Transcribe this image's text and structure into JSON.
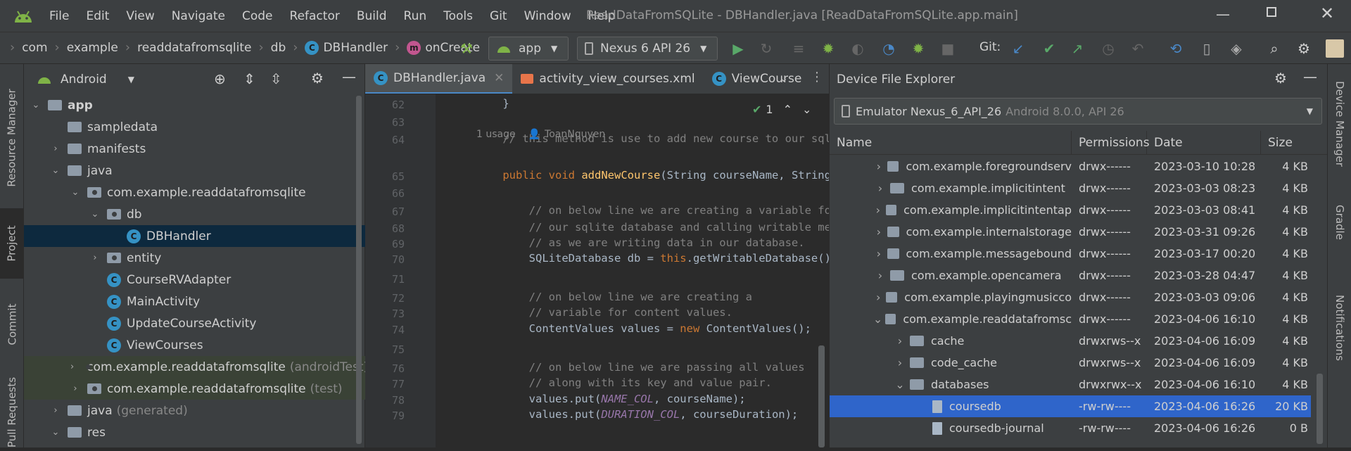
{
  "menu": {
    "items": [
      "File",
      "Edit",
      "View",
      "Navigate",
      "Code",
      "Refactor",
      "Build",
      "Run",
      "Tools",
      "Git",
      "Window",
      "Help"
    ],
    "title": "ReadDataFromSQLite - DBHandler.java [ReadDataFromSQLite.app.main]"
  },
  "breadcrumb": [
    "com",
    "example",
    "readdatafromsqlite",
    "db",
    "DBHandler",
    "onCreate"
  ],
  "toolbar": {
    "run_config": "app",
    "device": "Nexus 6 API 26",
    "git_label": "Git:"
  },
  "side_tabs": {
    "left": [
      "Resource Manager",
      "Project",
      "Commit",
      "Pull Requests"
    ],
    "right": [
      "Device Manager",
      "Gradle",
      "Notifications"
    ]
  },
  "project": {
    "view_label": "Android",
    "tree": [
      {
        "label": "app",
        "dim": ""
      },
      {
        "label": "sampledata",
        "dim": ""
      },
      {
        "label": "manifests",
        "dim": ""
      },
      {
        "label": "java",
        "dim": ""
      },
      {
        "label": "com.example.readdatafromsqlite",
        "dim": ""
      },
      {
        "label": "db",
        "dim": ""
      },
      {
        "label": "DBHandler",
        "dim": ""
      },
      {
        "label": "entity",
        "dim": ""
      },
      {
        "label": "CourseRVAdapter",
        "dim": ""
      },
      {
        "label": "MainActivity",
        "dim": ""
      },
      {
        "label": "UpdateCourseActivity",
        "dim": ""
      },
      {
        "label": "ViewCourses",
        "dim": ""
      },
      {
        "label": "com.example.readdatafromsqlite",
        "dim": "(androidTest)"
      },
      {
        "label": "com.example.readdatafromsqlite",
        "dim": "(test)"
      },
      {
        "label": "java",
        "dim": "(generated)"
      },
      {
        "label": "res",
        "dim": ""
      }
    ]
  },
  "editor": {
    "tabs": [
      "DBHandler.java",
      "activity_view_courses.xml",
      "ViewCourse"
    ],
    "inspection_count": "1",
    "usage_hint": "1 usage",
    "author": "ToanNguyen",
    "lines": [
      {
        "n": "62",
        "code": "    }"
      },
      {
        "n": "63",
        "code": ""
      },
      {
        "n": "64",
        "code": "    // this method is use to add new course to our sql"
      },
      {
        "n": "65",
        "code": "    public void addNewCourse(String courseName, String"
      },
      {
        "n": "66",
        "code": ""
      },
      {
        "n": "67",
        "code": "        // on below line we are creating a variable fo"
      },
      {
        "n": "68",
        "code": "        // our sqlite database and calling writable me"
      },
      {
        "n": "69",
        "code": "        // as we are writing data in our database."
      },
      {
        "n": "70",
        "code": "        SQLiteDatabase db = this.getWritableDatabase()"
      },
      {
        "n": "71",
        "code": ""
      },
      {
        "n": "72",
        "code": "        // on below line we are creating a"
      },
      {
        "n": "73",
        "code": "        // variable for content values."
      },
      {
        "n": "74",
        "code": "        ContentValues values = new ContentValues();"
      },
      {
        "n": "75",
        "code": ""
      },
      {
        "n": "76",
        "code": "        // on below line we are passing all values"
      },
      {
        "n": "77",
        "code": "        // along with its key and value pair."
      },
      {
        "n": "78",
        "code": "        values.put(NAME_COL, courseName);"
      },
      {
        "n": "79",
        "code": "        values.put(DURATION_COL, courseDuration);"
      }
    ]
  },
  "dfe": {
    "title": "Device File Explorer",
    "device": "Emulator Nexus_6_API_26",
    "device_detail": "Android 8.0.0, API 26",
    "columns": [
      "Name",
      "Permissions",
      "Date",
      "Size"
    ],
    "rows": [
      {
        "name": "com.example.foregroundserv",
        "perm": "drwx------",
        "date": "2023-03-10 10:28",
        "size": "4 KB"
      },
      {
        "name": "com.example.implicitintent",
        "perm": "drwx------",
        "date": "2023-03-03 08:23",
        "size": "4 KB"
      },
      {
        "name": "com.example.implicitintentap",
        "perm": "drwx------",
        "date": "2023-03-03 08:41",
        "size": "4 KB"
      },
      {
        "name": "com.example.internalstorage",
        "perm": "drwx------",
        "date": "2023-03-31 09:26",
        "size": "4 KB"
      },
      {
        "name": "com.example.messagebound",
        "perm": "drwx------",
        "date": "2023-03-17 00:20",
        "size": "4 KB"
      },
      {
        "name": "com.example.opencamera",
        "perm": "drwx------",
        "date": "2023-03-28 04:47",
        "size": "4 KB"
      },
      {
        "name": "com.example.playingmusicco",
        "perm": "drwx------",
        "date": "2023-03-03 09:06",
        "size": "4 KB"
      },
      {
        "name": "com.example.readdatafromsc",
        "perm": "drwx------",
        "date": "2023-04-06 16:10",
        "size": "4 KB"
      },
      {
        "name": "cache",
        "perm": "drwxrws--x",
        "date": "2023-04-06 16:09",
        "size": "4 KB"
      },
      {
        "name": "code_cache",
        "perm": "drwxrws--x",
        "date": "2023-04-06 16:09",
        "size": "4 KB"
      },
      {
        "name": "databases",
        "perm": "drwxrwx--x",
        "date": "2023-04-06 16:10",
        "size": "4 KB"
      },
      {
        "name": "coursedb",
        "perm": "-rw-rw----",
        "date": "2023-04-06 16:26",
        "size": "20 KB"
      },
      {
        "name": "coursedb-journal",
        "perm": "-rw-rw----",
        "date": "2023-04-06 16:26",
        "size": "0 B"
      }
    ]
  },
  "colors": {
    "accent": "#4a88c7",
    "selection": "#2f65ca",
    "android_green": "#7fb347"
  }
}
